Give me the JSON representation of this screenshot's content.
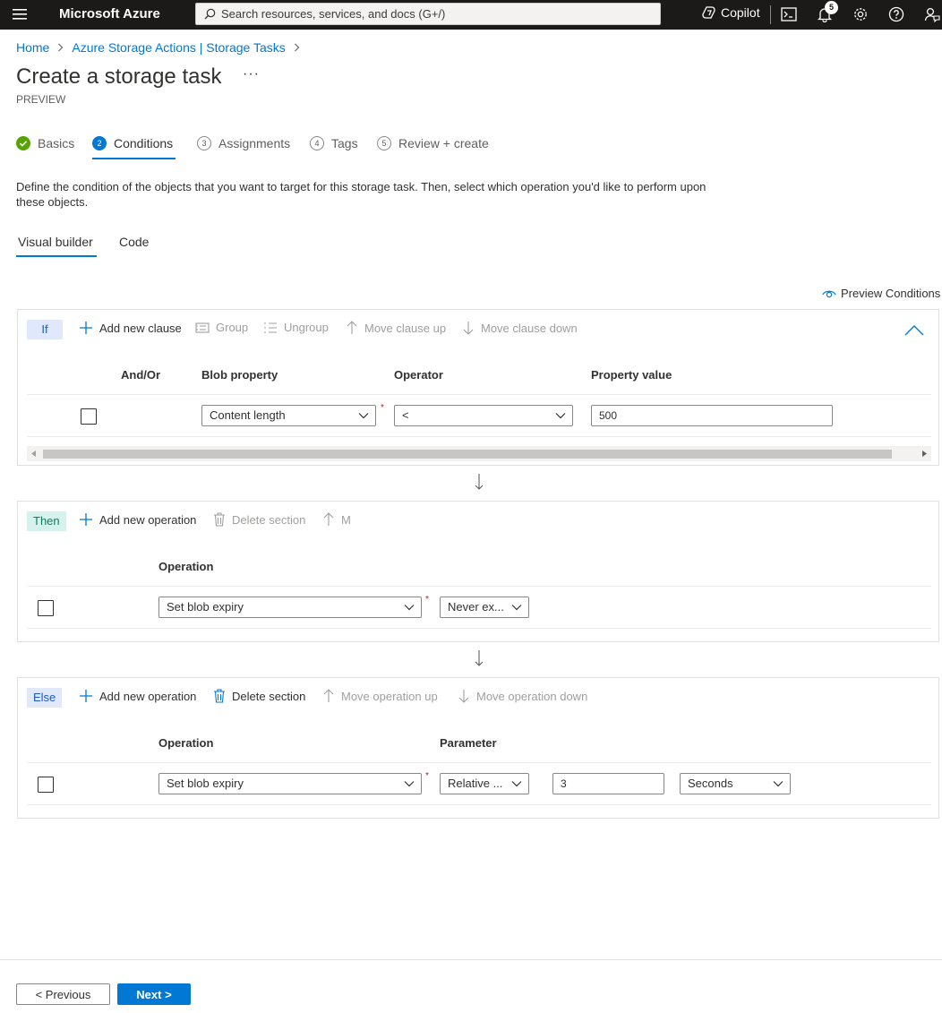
{
  "app": {
    "brand": "Microsoft Azure",
    "search_placeholder": "Search resources, services, and docs (G+/)",
    "copilot_label": "Copilot",
    "notification_count": "5"
  },
  "breadcrumb": {
    "items": [
      "Home",
      "Azure Storage Actions | Storage Tasks"
    ]
  },
  "page": {
    "title": "Create a storage task",
    "more": "···",
    "subtitle": "PREVIEW"
  },
  "steps": [
    {
      "num": "",
      "label": "Basics",
      "state": "done"
    },
    {
      "num": "2",
      "label": "Conditions",
      "state": "active"
    },
    {
      "num": "3",
      "label": "Assignments",
      "state": "pending"
    },
    {
      "num": "4",
      "label": "Tags",
      "state": "pending"
    },
    {
      "num": "5",
      "label": "Review + create",
      "state": "pending"
    }
  ],
  "description": "Define the condition of the objects that you want to target for this storage task. Then, select which operation you'd like to perform upon these objects.",
  "tabs": [
    "Visual builder",
    "Code"
  ],
  "preview_conditions": "Preview Conditions",
  "if_section": {
    "tag": "If",
    "toolbar": {
      "add": "Add new clause",
      "group": "Group",
      "ungroup": "Ungroup",
      "up": "Move clause up",
      "down": "Move clause down"
    },
    "columns": {
      "and_or": "And/Or",
      "property": "Blob property",
      "operator": "Operator",
      "value": "Property value"
    },
    "row": {
      "property": "Content length",
      "operator": "<",
      "value": "500"
    }
  },
  "then_section": {
    "tag": "Then",
    "toolbar": {
      "add": "Add new operation",
      "delete": "Delete section",
      "up": "M"
    },
    "columns": {
      "operation": "Operation"
    },
    "row": {
      "operation": "Set blob expiry",
      "param": "Never ex..."
    }
  },
  "else_section": {
    "tag": "Else",
    "toolbar": {
      "add": "Add new operation",
      "delete": "Delete section",
      "up": "Move operation up",
      "down": "Move operation down"
    },
    "columns": {
      "operation": "Operation",
      "parameter": "Parameter"
    },
    "row": {
      "operation": "Set blob expiry",
      "param": "Relative ...",
      "amount": "3",
      "unit": "Seconds"
    }
  },
  "footer": {
    "previous": "< Previous",
    "next": "Next >"
  },
  "colors": {
    "topbar": "#1b1a19",
    "accent": "#0078d4",
    "success": "#57a300",
    "if_tag_bg": "#dfe8fc",
    "then_tag_bg": "#d5f3ec",
    "else_tag_bg": "#e0e8fa"
  }
}
